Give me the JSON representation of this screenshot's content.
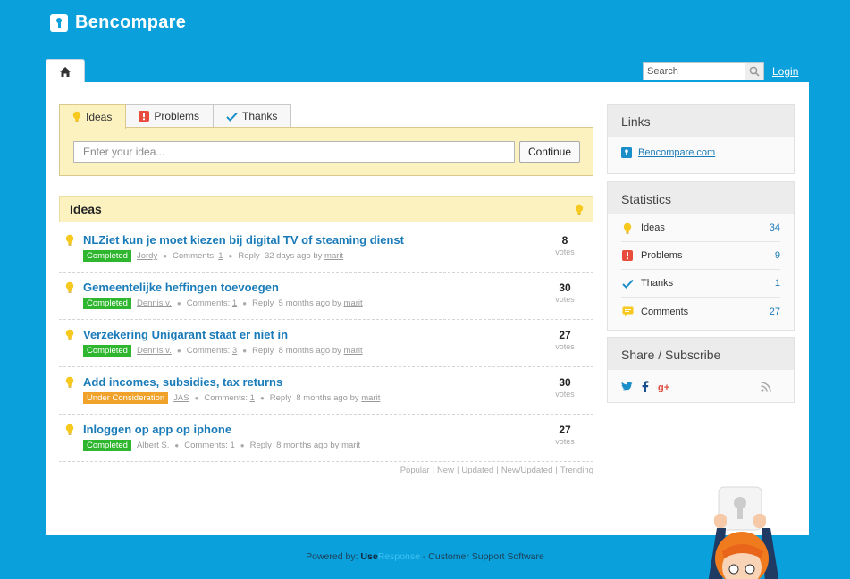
{
  "brand": {
    "name": "Bencompare"
  },
  "header": {
    "search_placeholder": "Search",
    "login_label": "Login"
  },
  "tabs": [
    {
      "label": "Ideas"
    },
    {
      "label": "Problems"
    },
    {
      "label": "Thanks"
    }
  ],
  "idea_form": {
    "placeholder": "Enter your idea...",
    "continue_label": "Continue"
  },
  "ideas_section": {
    "title": "Ideas"
  },
  "ideas": [
    {
      "title": "NLZiet kun je moet kiezen bij digital TV of steaming dienst",
      "status": "Completed",
      "author": "Jordy",
      "comments_label": "Comments:",
      "comments": "1",
      "reply": "Reply",
      "time": "32 days ago by",
      "by": "marit",
      "votes": "8",
      "votes_label": "votes"
    },
    {
      "title": "Gemeentelijke heffingen toevoegen",
      "status": "Completed",
      "author": "Dennis v.",
      "comments_label": "Comments:",
      "comments": "1",
      "reply": "Reply",
      "time": "5 months ago by",
      "by": "marit",
      "votes": "30",
      "votes_label": "votes"
    },
    {
      "title": "Verzekering Unigarant staat er niet in",
      "status": "Completed",
      "author": "Dennis v.",
      "comments_label": "Comments:",
      "comments": "3",
      "reply": "Reply",
      "time": "8 months ago by",
      "by": "marit",
      "votes": "27",
      "votes_label": "votes"
    },
    {
      "title": "Add incomes, subsidies, tax returns",
      "status": "Under Consideration",
      "author": "JAS",
      "comments_label": "Comments:",
      "comments": "1",
      "reply": "Reply",
      "time": "8 months ago by",
      "by": "marit",
      "votes": "30",
      "votes_label": "votes"
    },
    {
      "title": "Inloggen op app op iphone",
      "status": "Completed",
      "author": "Albert S.",
      "comments_label": "Comments:",
      "comments": "1",
      "reply": "Reply",
      "time": "8 months ago by",
      "by": "marit",
      "votes": "27",
      "votes_label": "votes"
    }
  ],
  "sort_links": [
    "Popular",
    "New",
    "Updated",
    "New/Updated",
    "Trending"
  ],
  "sidebar": {
    "links_title": "Links",
    "links": [
      {
        "label": "Bencompare.com"
      }
    ],
    "stats_title": "Statistics",
    "stats": [
      {
        "label": "Ideas",
        "value": "34"
      },
      {
        "label": "Problems",
        "value": "9"
      },
      {
        "label": "Thanks",
        "value": "1"
      },
      {
        "label": "Comments",
        "value": "27"
      }
    ],
    "share_title": "Share / Subscribe"
  },
  "footer": {
    "prefix": "Powered by:",
    "brand_a": "Use",
    "brand_b": "Response",
    "suffix": "- Customer Support Software"
  },
  "colors": {
    "background": "#0aa0dc",
    "link": "#1a7bb9",
    "completed": "#2fb62f",
    "under_consideration": "#f0a22a",
    "idea_highlight": "#fcf2c0"
  },
  "icons": [
    "home-icon",
    "search-icon",
    "bulb-icon",
    "problem-icon",
    "check-icon",
    "comment-icon",
    "twitter-icon",
    "facebook-icon",
    "google-plus-icon",
    "rss-icon"
  ]
}
